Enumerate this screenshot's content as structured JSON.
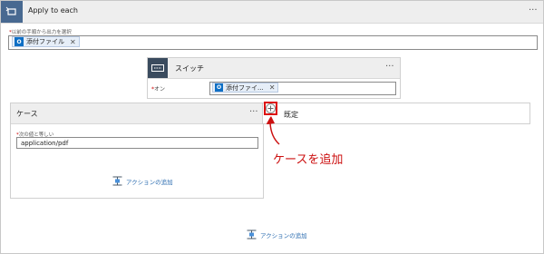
{
  "apply_to_each": {
    "title": "Apply to each",
    "field_label": "以前の手順から出力を選択",
    "token_label": "添付ファイル"
  },
  "switch_card": {
    "title": "スイッチ",
    "on_label": "オン",
    "token_label": "添付ファイ..."
  },
  "case_card": {
    "title": "ケース",
    "equals_label": "次の値と等しい",
    "equals_value": "application/pdf",
    "add_action_label": "アクションの追加"
  },
  "default_card": {
    "title": "既定"
  },
  "add_case_button": {
    "icon": "plus-icon"
  },
  "annotation": {
    "text": "ケースを追加",
    "color": "#cc1111"
  },
  "outer_add_action": {
    "label": "アクションの追加"
  },
  "more_glyph": "···",
  "required_mark": "*",
  "remove_glyph": "✕"
}
